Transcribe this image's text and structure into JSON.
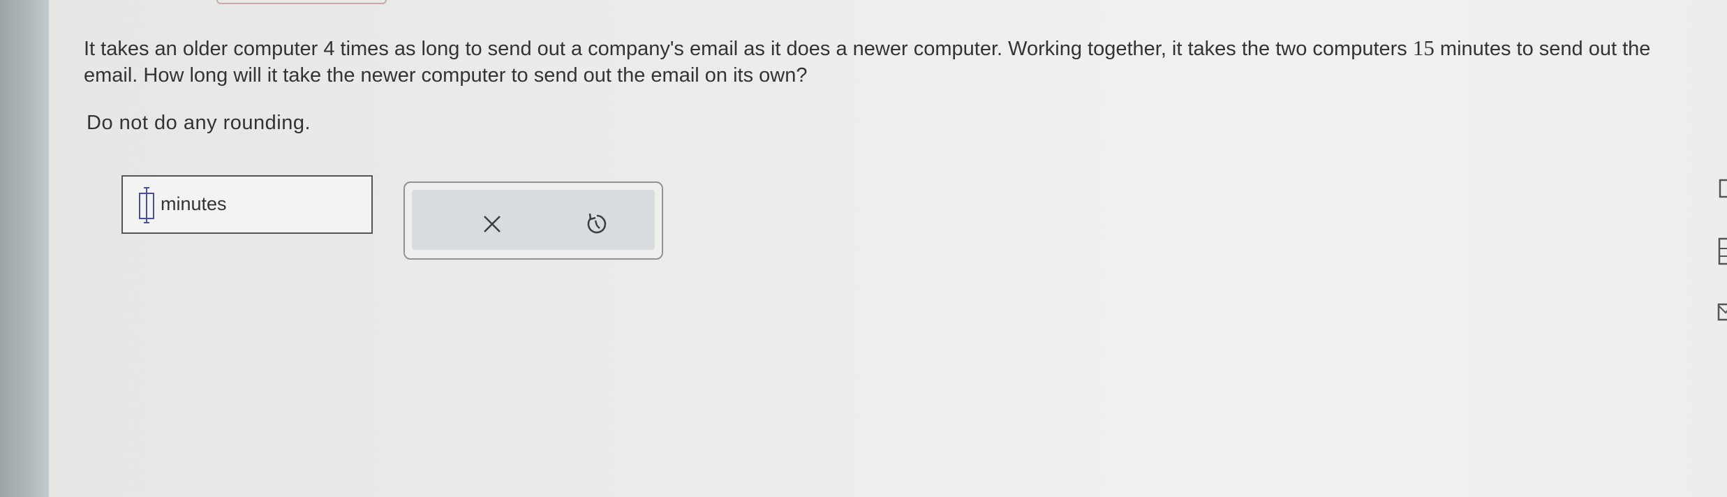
{
  "question": {
    "part1": "It takes an older computer 4 times as long to send out a company's email as it does a newer computer. Working together, it takes the two computers ",
    "minutes_value": "15",
    "part2": " minutes to send out the email. How long will it take the newer computer to send out the email on its own?"
  },
  "instruction": "Do not do any rounding.",
  "answer": {
    "value": "",
    "unit": "minutes"
  },
  "actions": {
    "clear_icon": "close-x-icon",
    "undo_icon": "undo-icon"
  },
  "side_toolbar": {
    "icons": [
      "panel-icon",
      "calculator-icon",
      "mail-icon"
    ]
  },
  "colors": {
    "text": "#333333",
    "input_border": "#555555",
    "icon_purple": "#4a4f9c",
    "panel_border": "#8e9397",
    "panel_fill": "#d8dcdf"
  }
}
